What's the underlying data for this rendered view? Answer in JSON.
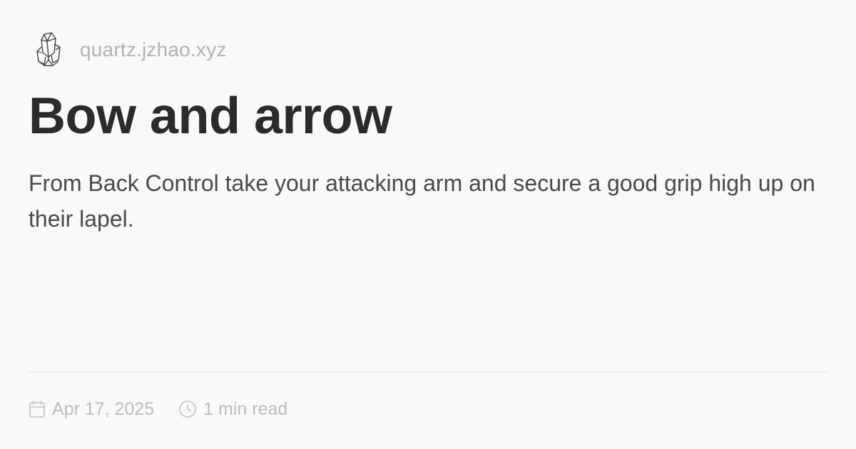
{
  "header": {
    "site_name": "quartz.jzhao.xyz",
    "logo_icon": "crystal-logo-icon"
  },
  "page": {
    "title": "Bow and arrow",
    "description": "From Back Control take your attacking arm and secure a good grip high up on their lapel."
  },
  "footer": {
    "date": "Apr 17, 2025",
    "date_icon": "calendar-icon",
    "read_time": "1 min read",
    "read_time_icon": "clock-icon"
  },
  "colors": {
    "background": "#faf8f8",
    "title": "#2b2b2b",
    "muted": "#bdbdbd"
  }
}
